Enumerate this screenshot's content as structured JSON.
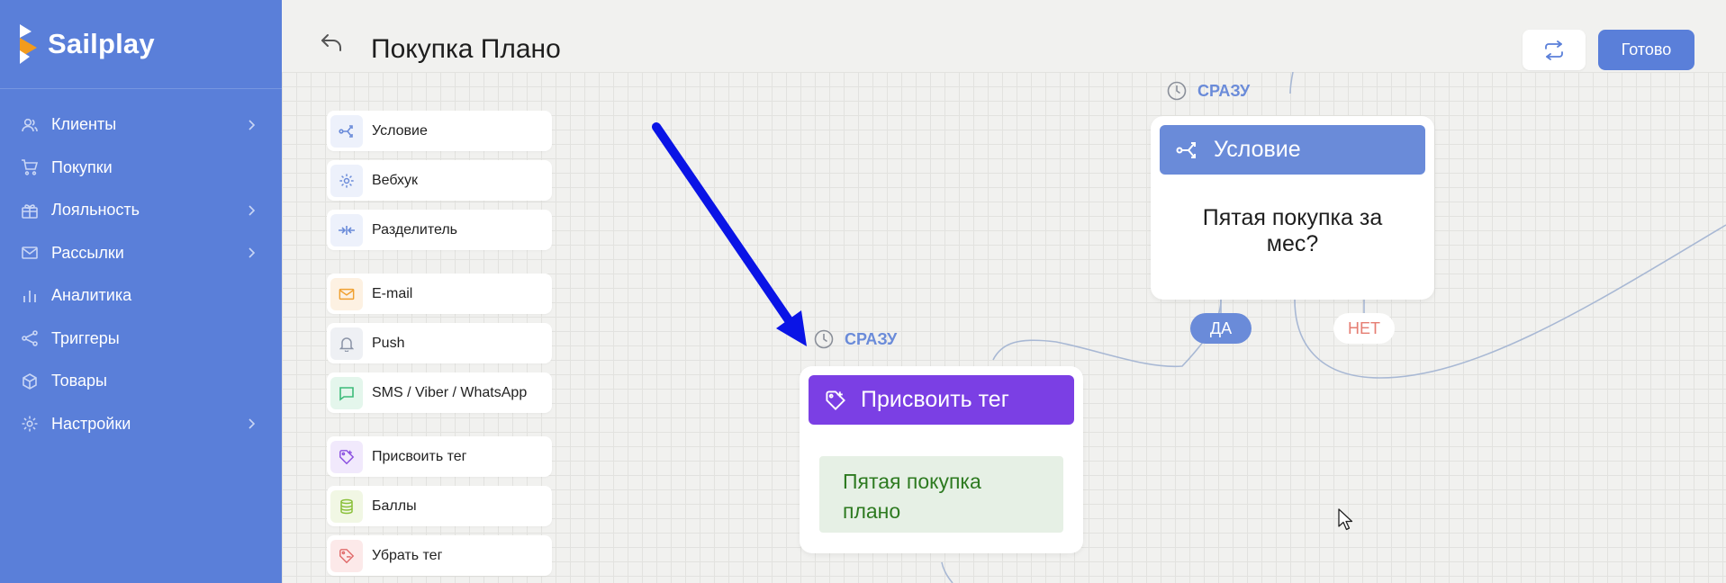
{
  "app": {
    "name": "Sailplay"
  },
  "sidebar": {
    "items": [
      {
        "label": "Клиенты",
        "icon": "users-icon",
        "has_children": true
      },
      {
        "label": "Покупки",
        "icon": "cart-icon",
        "has_children": false
      },
      {
        "label": "Лояльность",
        "icon": "gift-icon",
        "has_children": true
      },
      {
        "label": "Рассылки",
        "icon": "mail-icon",
        "has_children": true
      },
      {
        "label": "Аналитика",
        "icon": "bar-chart-icon",
        "has_children": false
      },
      {
        "label": "Триггеры",
        "icon": "share-nodes-icon",
        "has_children": false
      },
      {
        "label": "Товары",
        "icon": "box-icon",
        "has_children": false
      },
      {
        "label": "Настройки",
        "icon": "gear-icon",
        "has_children": true
      }
    ]
  },
  "header": {
    "title": "Покупка Плано",
    "done_label": "Готово"
  },
  "palette": {
    "items": [
      {
        "label": "Условие",
        "icon": "branch-icon",
        "color": "#6a8bd9"
      },
      {
        "label": "Вебхук",
        "icon": "gear-icon",
        "color": "#6a8bd9"
      },
      {
        "label": "Разделитель",
        "icon": "split-icon",
        "color": "#6a8bd9"
      },
      {
        "label": "E-mail",
        "icon": "mail-icon",
        "color": "#f0a030"
      },
      {
        "label": "Push",
        "icon": "bell-icon",
        "color": "#8a93a6"
      },
      {
        "label": "SMS / Viber / WhatsApp",
        "icon": "chat-icon",
        "color": "#3dbb7a"
      },
      {
        "label": "Присвоить тег",
        "icon": "tag-plus-icon",
        "color": "#8a4fe0"
      },
      {
        "label": "Баллы",
        "icon": "coins-icon",
        "color": "#8ac03a"
      },
      {
        "label": "Убрать тег",
        "icon": "tag-minus-icon",
        "color": "#e06a6a"
      }
    ]
  },
  "condition_node": {
    "timing": "СРАЗУ",
    "title": "Условие",
    "text_line1": "Пятая покупка за",
    "text_line2": "мес?",
    "yes_label": "ДА",
    "no_label": "НЕТ",
    "color": "#6a8bd9"
  },
  "tag_node": {
    "timing": "СРАЗУ",
    "title": "Присвоить тег",
    "tag_line1": "Пятая покупка",
    "tag_line2": "плано",
    "color": "#7b3fe4"
  },
  "colors": {
    "sidebar": "#5a7fd9",
    "accent": "#5a7fd9",
    "arrow": "#0a14e6",
    "no_branch": "#e57d72",
    "tag_text": "#2d7a20"
  }
}
